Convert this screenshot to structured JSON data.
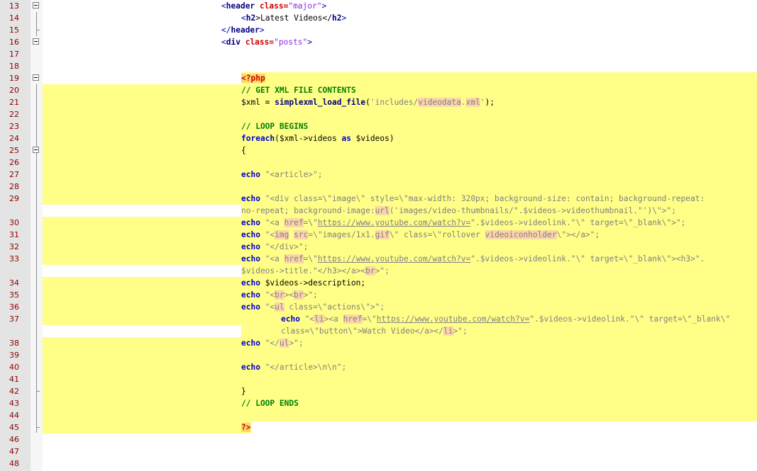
{
  "editor": {
    "line_numbers": [
      "13",
      "14",
      "15",
      "16",
      "17",
      "18",
      "19",
      "20",
      "21",
      "22",
      "23",
      "24",
      "25",
      "26",
      "27",
      "28",
      "29",
      "30",
      "31",
      "32",
      "33",
      "34",
      "35",
      "36",
      "37",
      "38",
      "39",
      "40",
      "41",
      "42",
      "43",
      "44",
      "45",
      "46",
      "47",
      "48"
    ],
    "code": {
      "l13_open": "<",
      "l13_tag": "header",
      "l13_attr": " class=",
      "l13_val": "\"major\"",
      "l13_close": ">",
      "l14_open": "<",
      "l14_tag": "h2",
      "l14_text": ">Latest Videos</",
      "l14_tag2": "h2",
      "l14_close": ">",
      "l15_open": "</",
      "l15_tag": "header",
      "l15_close": ">",
      "l16_open": "<",
      "l16_tag": "div",
      "l16_attr": " class=",
      "l16_val": "\"posts\"",
      "l16_close": ">",
      "l19": "<?php",
      "l20": "// GET XML FILE CONTENTS",
      "l21_a": "$xml = ",
      "l21_fn": "simplexml_load_file",
      "l21_b": "(",
      "l21_s1": "'includes/",
      "l21_s2": "videodata",
      "l21_s3": ".",
      "l21_s4": "xml",
      "l21_s5": "'",
      "l21_c": ");",
      "l23": "// LOOP BEGINS",
      "l24_kw": "foreach",
      "l24_a": "($xml->videos ",
      "l24_as": "as",
      "l24_b": " $videos)",
      "l25": "{",
      "l27_kw": "echo",
      "l27_s": " \"<article>\";",
      "l29_kw": "echo",
      "l29_s": " \"<div class=\\\"image\\\" style=\\\"max-width: 320px; background-size: contain; background-repeat:",
      "l29w_a": "no-repeat; background-image:",
      "l29w_url": "url",
      "l29w_b": "('images/video-thumbnails/\".$videos->videothumbnail.\"')\\\">\";",
      "l30_kw": "echo",
      "l30_a": " \"<a ",
      "l30_href": "href",
      "l30_b": "=\\\"",
      "l30_link": "https://www.youtube.com/watch?v=",
      "l30_c": "\".$videos->videolink.\"\\\" target=\\\"_blank\\\">\";",
      "l31_kw": "echo",
      "l31_a": " \"<",
      "l31_img": "img",
      "l31_b": " ",
      "l31_src": "src",
      "l31_c": "=\\\"images/1x1.",
      "l31_gif": "gif",
      "l31_d": "\\\" class=\\\"rollover ",
      "l31_cls": "videoiconholder",
      "l31_e": "\\\"></a>\";",
      "l32_kw": "echo",
      "l32_s": " \"</div>\";",
      "l33_kw": "echo",
      "l33_a": " \"<a ",
      "l33_href": "href",
      "l33_b": "=\\\"",
      "l33_link": "https://www.youtube.com/watch?v=",
      "l33_c": "\".$videos->videolink.\"\\\" target=\\\"_blank\\\"><h3>\".",
      "l33w_a": "$videos->title.\"</h3></a><",
      "l33w_br": "br",
      "l33w_b": ">\";",
      "l34_kw": "echo",
      "l34_s": " $videos->description;",
      "l35_kw": "echo",
      "l35_a": " \"<",
      "l35_br1": "br",
      "l35_b": "><",
      "l35_br2": "br",
      "l35_c": ">\";",
      "l36_kw": "echo",
      "l36_a": " \"<",
      "l36_ul": "ul",
      "l36_b": " class=\\\"actions\\\">\";",
      "l37_kw": "echo",
      "l37_a": " \"<",
      "l37_li": "li",
      "l37_b": "><a ",
      "l37_href": "href",
      "l37_c": "=\\\"",
      "l37_link": "https://www.youtube.com/watch?v=",
      "l37_d": "\".$videos->videolink.\"\\\" target=\\\"_blank\\\"",
      "l37w_a": "class=\\\"button\\\">Watch Video</a></",
      "l37w_li": "li",
      "l37w_b": ">\";",
      "l38_kw": "echo",
      "l38_a": " \"</",
      "l38_ul": "ul",
      "l38_b": ">\";",
      "l40_kw": "echo",
      "l40_s": " \"</article>\\n\\n\";",
      "l42": "}",
      "l43": "// LOOP ENDS",
      "l45": "?>"
    }
  }
}
